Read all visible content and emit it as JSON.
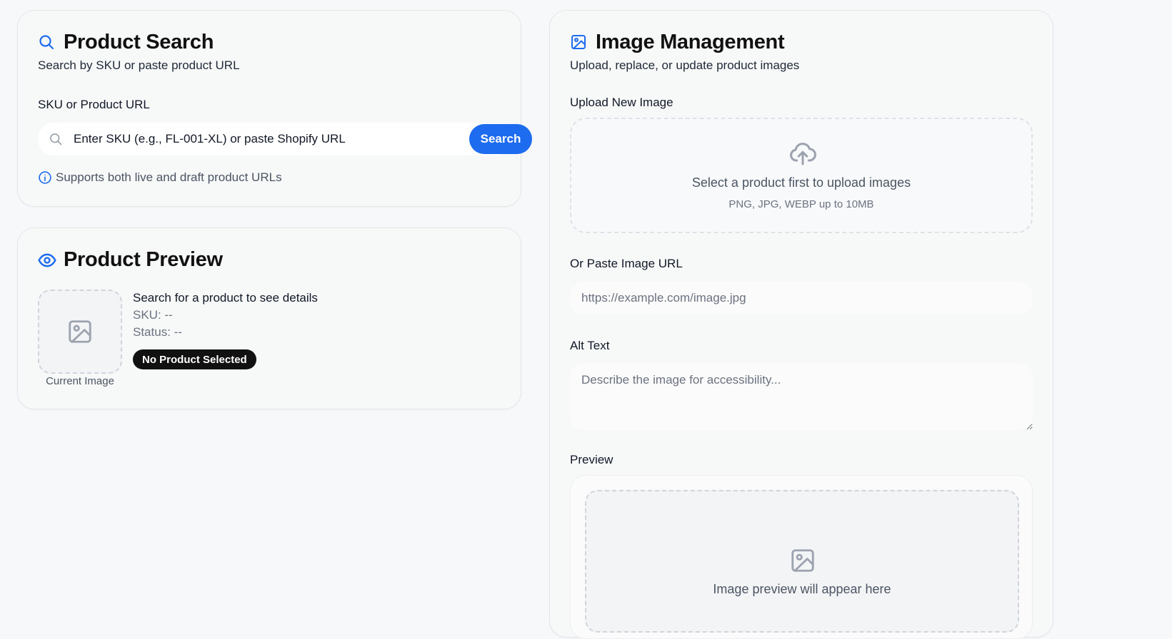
{
  "search_card": {
    "title": "Product Search",
    "subtitle": "Search by SKU or paste product URL",
    "field_label": "SKU or Product URL",
    "input_placeholder": "Enter SKU (e.g., FL-001-XL) or paste Shopify URL",
    "search_button": "Search",
    "hint": "Supports both live and draft product URLs"
  },
  "preview_card": {
    "title": "Product Preview",
    "image_caption": "Current Image",
    "info_title": "Search for a product to see details",
    "sku_line": "SKU: --",
    "status_line": "Status: --",
    "badge": "No Product Selected"
  },
  "image_card": {
    "title": "Image Management",
    "subtitle": "Upload, replace, or update product images",
    "upload_label": "Upload New Image",
    "upload_text": "Select a product first to upload images",
    "upload_formats": "PNG, JPG, WEBP up to 10MB",
    "url_label": "Or Paste Image URL",
    "url_placeholder": "https://example.com/image.jpg",
    "alt_label": "Alt Text",
    "alt_placeholder": "Describe the image for accessibility...",
    "preview_label": "Preview",
    "preview_text": "Image preview will appear here"
  },
  "colors": {
    "accent": "#1d6cf0",
    "badge_bg": "#111111"
  },
  "icons": [
    "search-icon",
    "info-icon",
    "eye-icon",
    "image-icon",
    "upload-cloud-icon"
  ]
}
